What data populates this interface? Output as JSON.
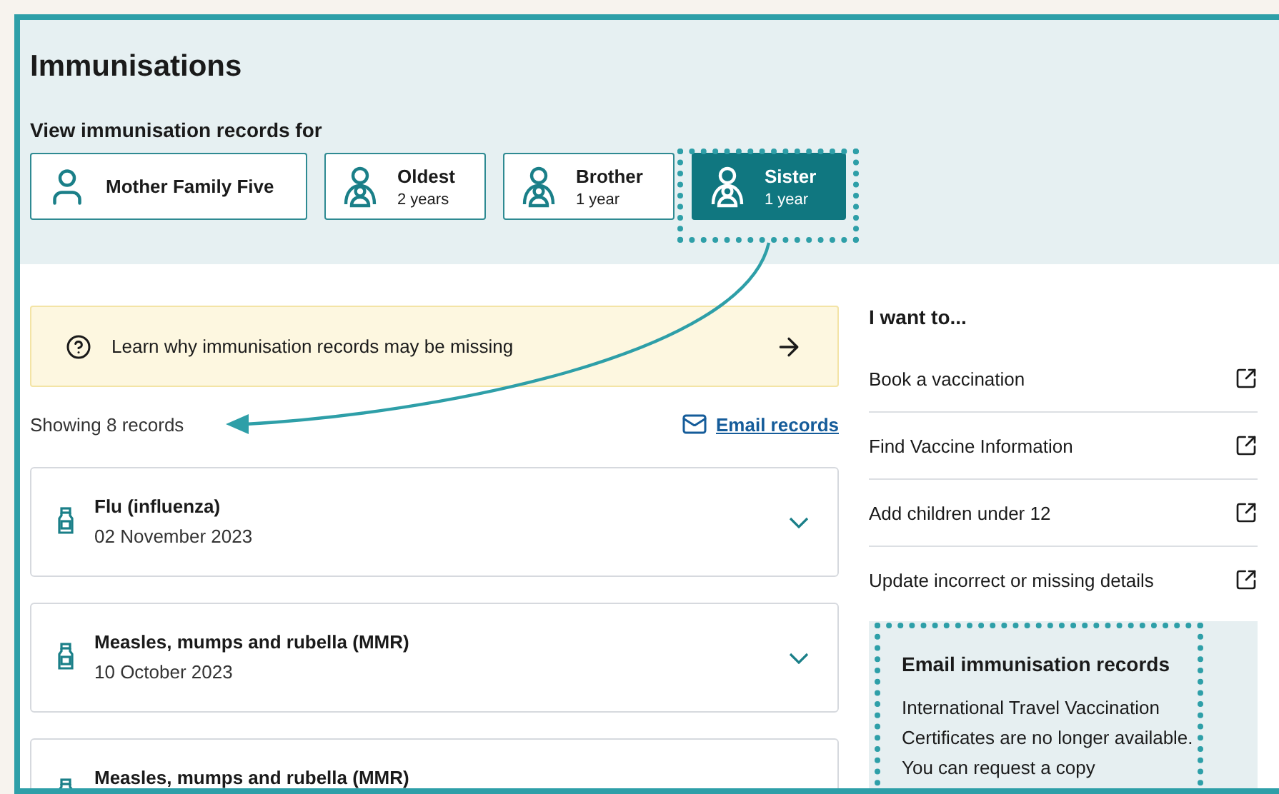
{
  "title": "Immunisations",
  "prompt": "View immunisation records for",
  "people": [
    {
      "name": "Mother Family Five",
      "kind": "adult",
      "selected": false
    },
    {
      "name": "Oldest",
      "age": "2 years",
      "kind": "child",
      "selected": false
    },
    {
      "name": "Brother",
      "age": "1 year",
      "kind": "child",
      "selected": false
    },
    {
      "name": "Sister",
      "age": "1 year",
      "kind": "child",
      "selected": true
    }
  ],
  "banner": "Learn why immunisation records may be missing",
  "showing": "Showing 8 records",
  "email_link": "Email records",
  "records": [
    {
      "name": "Flu (influenza)",
      "date": "02 November 2023"
    },
    {
      "name": "Measles, mumps and rubella (MMR)",
      "date": "10 October 2023"
    },
    {
      "name": "Measles, mumps and rubella (MMR)"
    }
  ],
  "sidebar": {
    "heading": "I want to...",
    "links": [
      "Book a vaccination",
      "Find Vaccine Information",
      "Add children under 12",
      "Update incorrect or missing details"
    ]
  },
  "email_card": {
    "title": "Email immunisation records",
    "body": "International Travel Vaccination Certificates are no longer available. You can request a copy"
  }
}
